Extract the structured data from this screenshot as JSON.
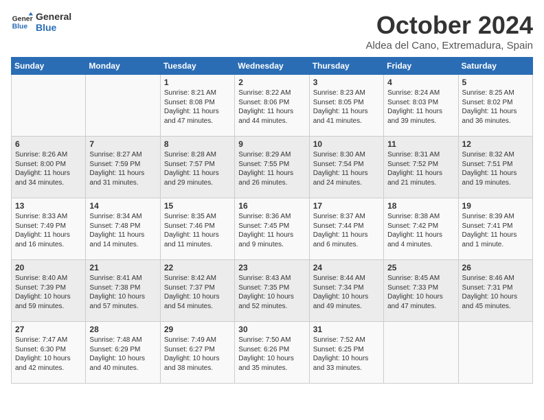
{
  "header": {
    "logo_line1": "General",
    "logo_line2": "Blue",
    "month": "October 2024",
    "location": "Aldea del Cano, Extremadura, Spain"
  },
  "days_of_week": [
    "Sunday",
    "Monday",
    "Tuesday",
    "Wednesday",
    "Thursday",
    "Friday",
    "Saturday"
  ],
  "weeks": [
    [
      {
        "day": "",
        "content": ""
      },
      {
        "day": "",
        "content": ""
      },
      {
        "day": "1",
        "content": "Sunrise: 8:21 AM\nSunset: 8:08 PM\nDaylight: 11 hours and 47 minutes."
      },
      {
        "day": "2",
        "content": "Sunrise: 8:22 AM\nSunset: 8:06 PM\nDaylight: 11 hours and 44 minutes."
      },
      {
        "day": "3",
        "content": "Sunrise: 8:23 AM\nSunset: 8:05 PM\nDaylight: 11 hours and 41 minutes."
      },
      {
        "day": "4",
        "content": "Sunrise: 8:24 AM\nSunset: 8:03 PM\nDaylight: 11 hours and 39 minutes."
      },
      {
        "day": "5",
        "content": "Sunrise: 8:25 AM\nSunset: 8:02 PM\nDaylight: 11 hours and 36 minutes."
      }
    ],
    [
      {
        "day": "6",
        "content": "Sunrise: 8:26 AM\nSunset: 8:00 PM\nDaylight: 11 hours and 34 minutes."
      },
      {
        "day": "7",
        "content": "Sunrise: 8:27 AM\nSunset: 7:59 PM\nDaylight: 11 hours and 31 minutes."
      },
      {
        "day": "8",
        "content": "Sunrise: 8:28 AM\nSunset: 7:57 PM\nDaylight: 11 hours and 29 minutes."
      },
      {
        "day": "9",
        "content": "Sunrise: 8:29 AM\nSunset: 7:55 PM\nDaylight: 11 hours and 26 minutes."
      },
      {
        "day": "10",
        "content": "Sunrise: 8:30 AM\nSunset: 7:54 PM\nDaylight: 11 hours and 24 minutes."
      },
      {
        "day": "11",
        "content": "Sunrise: 8:31 AM\nSunset: 7:52 PM\nDaylight: 11 hours and 21 minutes."
      },
      {
        "day": "12",
        "content": "Sunrise: 8:32 AM\nSunset: 7:51 PM\nDaylight: 11 hours and 19 minutes."
      }
    ],
    [
      {
        "day": "13",
        "content": "Sunrise: 8:33 AM\nSunset: 7:49 PM\nDaylight: 11 hours and 16 minutes."
      },
      {
        "day": "14",
        "content": "Sunrise: 8:34 AM\nSunset: 7:48 PM\nDaylight: 11 hours and 14 minutes."
      },
      {
        "day": "15",
        "content": "Sunrise: 8:35 AM\nSunset: 7:46 PM\nDaylight: 11 hours and 11 minutes."
      },
      {
        "day": "16",
        "content": "Sunrise: 8:36 AM\nSunset: 7:45 PM\nDaylight: 11 hours and 9 minutes."
      },
      {
        "day": "17",
        "content": "Sunrise: 8:37 AM\nSunset: 7:44 PM\nDaylight: 11 hours and 6 minutes."
      },
      {
        "day": "18",
        "content": "Sunrise: 8:38 AM\nSunset: 7:42 PM\nDaylight: 11 hours and 4 minutes."
      },
      {
        "day": "19",
        "content": "Sunrise: 8:39 AM\nSunset: 7:41 PM\nDaylight: 11 hours and 1 minute."
      }
    ],
    [
      {
        "day": "20",
        "content": "Sunrise: 8:40 AM\nSunset: 7:39 PM\nDaylight: 10 hours and 59 minutes."
      },
      {
        "day": "21",
        "content": "Sunrise: 8:41 AM\nSunset: 7:38 PM\nDaylight: 10 hours and 57 minutes."
      },
      {
        "day": "22",
        "content": "Sunrise: 8:42 AM\nSunset: 7:37 PM\nDaylight: 10 hours and 54 minutes."
      },
      {
        "day": "23",
        "content": "Sunrise: 8:43 AM\nSunset: 7:35 PM\nDaylight: 10 hours and 52 minutes."
      },
      {
        "day": "24",
        "content": "Sunrise: 8:44 AM\nSunset: 7:34 PM\nDaylight: 10 hours and 49 minutes."
      },
      {
        "day": "25",
        "content": "Sunrise: 8:45 AM\nSunset: 7:33 PM\nDaylight: 10 hours and 47 minutes."
      },
      {
        "day": "26",
        "content": "Sunrise: 8:46 AM\nSunset: 7:31 PM\nDaylight: 10 hours and 45 minutes."
      }
    ],
    [
      {
        "day": "27",
        "content": "Sunrise: 7:47 AM\nSunset: 6:30 PM\nDaylight: 10 hours and 42 minutes."
      },
      {
        "day": "28",
        "content": "Sunrise: 7:48 AM\nSunset: 6:29 PM\nDaylight: 10 hours and 40 minutes."
      },
      {
        "day": "29",
        "content": "Sunrise: 7:49 AM\nSunset: 6:27 PM\nDaylight: 10 hours and 38 minutes."
      },
      {
        "day": "30",
        "content": "Sunrise: 7:50 AM\nSunset: 6:26 PM\nDaylight: 10 hours and 35 minutes."
      },
      {
        "day": "31",
        "content": "Sunrise: 7:52 AM\nSunset: 6:25 PM\nDaylight: 10 hours and 33 minutes."
      },
      {
        "day": "",
        "content": ""
      },
      {
        "day": "",
        "content": ""
      }
    ]
  ]
}
